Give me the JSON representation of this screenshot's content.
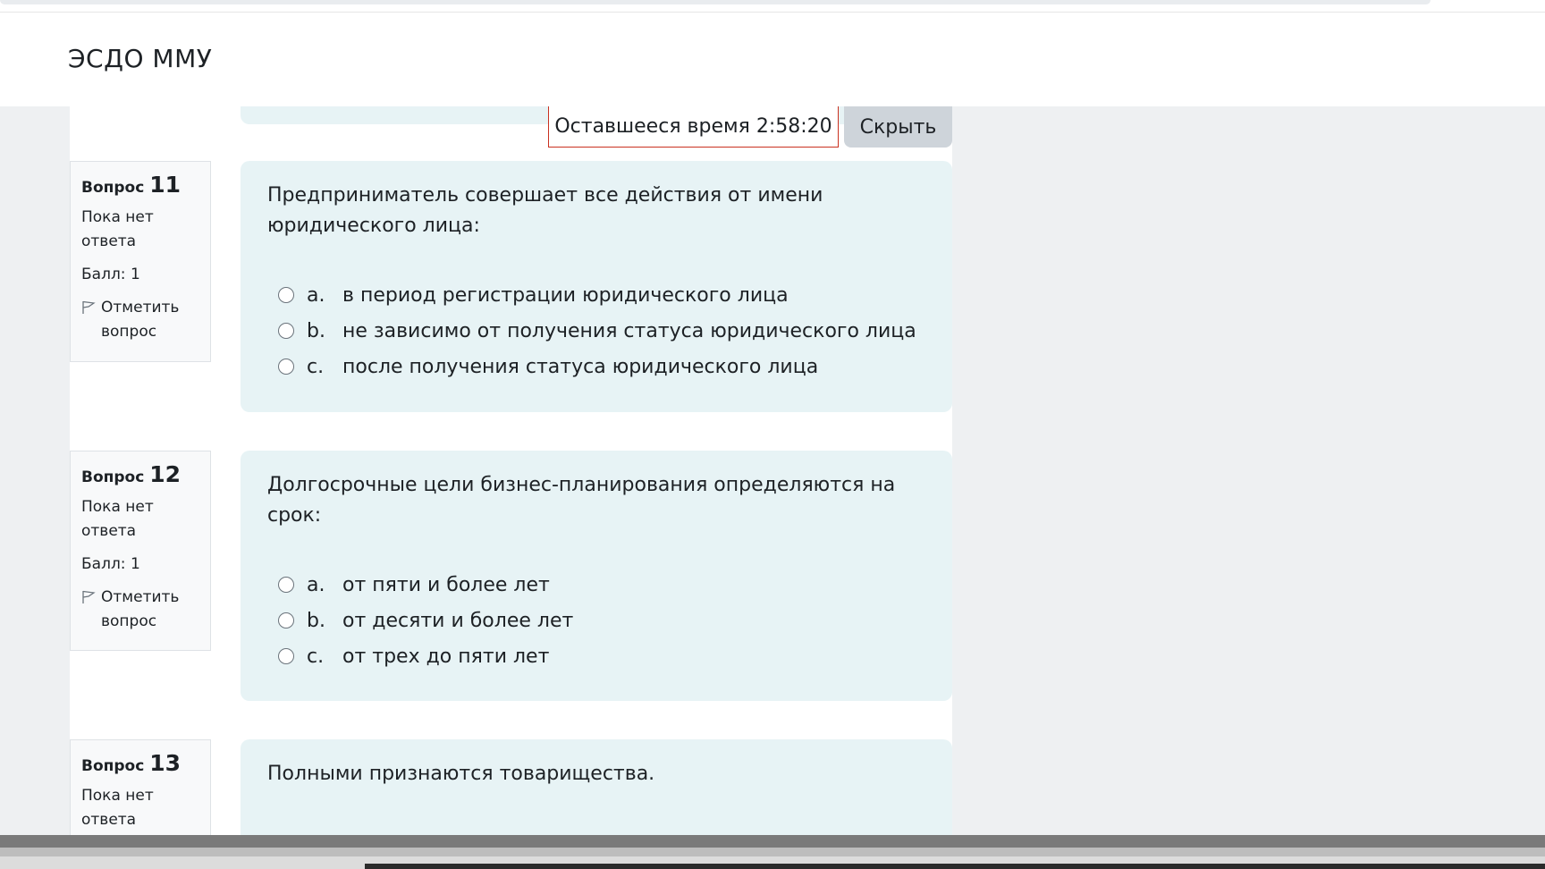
{
  "site": {
    "title": "ЭСДО ММУ"
  },
  "timer": {
    "text": "Оставшееся время 2:58:20",
    "hide_label": "Скрыть"
  },
  "questions": [
    {
      "label": "Вопрос",
      "number": "11",
      "state": "Пока нет ответа",
      "grade": "Балл: 1",
      "flag_label": "Отметить вопрос",
      "text": "Предприниматель совершает все действия от имени юридического лица:",
      "answers": [
        {
          "letter": "a.",
          "text": "в период регистрации юридического лица"
        },
        {
          "letter": "b.",
          "text": "не зависимо от получения статуса юридического лица"
        },
        {
          "letter": "c.",
          "text": "после получения статуса юридического лица"
        }
      ]
    },
    {
      "label": "Вопрос",
      "number": "12",
      "state": "Пока нет ответа",
      "grade": "Балл: 1",
      "flag_label": "Отметить вопрос",
      "text": "Долгосрочные цели бизнес-планирования определяются на срок:",
      "answers": [
        {
          "letter": "a.",
          "text": "от пяти и более лет"
        },
        {
          "letter": "b.",
          "text": "от десяти и более лет"
        },
        {
          "letter": "c.",
          "text": "от трех до пяти лет"
        }
      ]
    },
    {
      "label": "Вопрос",
      "number": "13",
      "state": "Пока нет ответа",
      "text": "Полными признаются товарищества."
    }
  ],
  "colors": {
    "card_bg": "#e7f3f5",
    "timer_border": "#ca3120",
    "hide_button_bg": "#ced4da",
    "page_bg": "#eef0f2"
  }
}
